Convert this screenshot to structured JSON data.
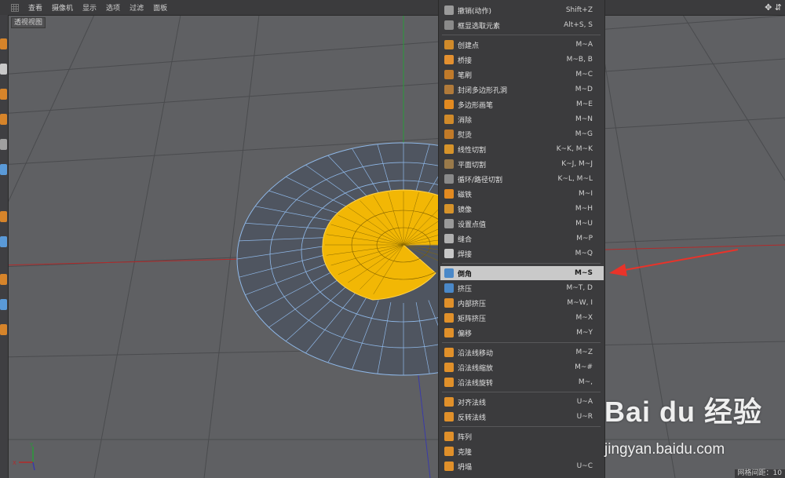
{
  "menubar": {
    "items": [
      "查看",
      "摄像机",
      "显示",
      "选项",
      "过滤",
      "面板"
    ]
  },
  "viewport": {
    "label": "透视视图",
    "grid_label": "网格间距：10"
  },
  "context_menu": {
    "items": [
      {
        "label": "撤销(动作)",
        "shortcut": "Shift+Z",
        "icon": "undo-icon",
        "color": "#9a9a9a"
      },
      {
        "label": "框显选取元素",
        "shortcut": "Alt+S, S",
        "icon": "frame-selected-icon",
        "color": "#8a8a8a"
      },
      {
        "label": "创建点",
        "shortcut": "M~A",
        "icon": "create-point-icon",
        "color": "#d08a2a"
      },
      {
        "label": "桥接",
        "shortcut": "M~B, B",
        "icon": "bridge-icon",
        "color": "#e39030"
      },
      {
        "label": "笔刷",
        "shortcut": "M~C",
        "icon": "brush-icon",
        "color": "#c07a2a"
      },
      {
        "label": "封闭多边形孔洞",
        "shortcut": "M~D",
        "icon": "close-hole-icon",
        "color": "#b07a3a"
      },
      {
        "label": "多边形画笔",
        "shortcut": "M~E",
        "icon": "polygon-pen-icon",
        "color": "#e38a20"
      },
      {
        "label": "消除",
        "shortcut": "M~N",
        "icon": "dissolve-icon",
        "color": "#d08a2a"
      },
      {
        "label": "熨烫",
        "shortcut": "M~G",
        "icon": "iron-icon",
        "color": "#c27a28"
      },
      {
        "label": "线性切割",
        "shortcut": "K~K, M~K",
        "icon": "line-cut-icon",
        "color": "#d6932a"
      },
      {
        "label": "平面切割",
        "shortcut": "K~J, M~J",
        "icon": "plane-cut-icon",
        "color": "#9a7a4a"
      },
      {
        "label": "循环/路径切割",
        "shortcut": "K~L, M~L",
        "icon": "loop-cut-icon",
        "color": "#8a8a8a"
      },
      {
        "label": "磁铁",
        "shortcut": "M~I",
        "icon": "magnet-icon",
        "color": "#e38a20"
      },
      {
        "label": "镜像",
        "shortcut": "M~H",
        "icon": "mirror-icon",
        "color": "#d6932a"
      },
      {
        "label": "设置点值",
        "shortcut": "M~U",
        "icon": "set-point-value-icon",
        "color": "#9a9a9a"
      },
      {
        "label": "缝合",
        "shortcut": "M~P",
        "icon": "stitch-icon",
        "color": "#b0b0b0"
      },
      {
        "label": "焊接",
        "shortcut": "M~Q",
        "icon": "weld-icon",
        "color": "#c8c8c8"
      },
      {
        "label": "倒角",
        "shortcut": "M~S",
        "icon": "bevel-icon",
        "color": "#4a88c8"
      },
      {
        "label": "挤压",
        "shortcut": "M~T, D",
        "icon": "extrude-icon",
        "color": "#4a88c8"
      },
      {
        "label": "内部挤压",
        "shortcut": "M~W, I",
        "icon": "extrude-inner-icon",
        "color": "#e0902a"
      },
      {
        "label": "矩阵挤压",
        "shortcut": "M~X",
        "icon": "matrix-extrude-icon",
        "color": "#e0902a"
      },
      {
        "label": "偏移",
        "shortcut": "M~Y",
        "icon": "smooth-shift-icon",
        "color": "#e0902a"
      },
      {
        "label": "沿法线移动",
        "shortcut": "M~Z",
        "icon": "normal-move-icon",
        "color": "#e0902a"
      },
      {
        "label": "沿法线缩放",
        "shortcut": "M~#",
        "icon": "normal-scale-icon",
        "color": "#e0902a"
      },
      {
        "label": "沿法线旋转",
        "shortcut": "M~,",
        "icon": "normal-rotate-icon",
        "color": "#e0902a"
      },
      {
        "label": "对齐法线",
        "shortcut": "U~A",
        "icon": "align-normals-icon",
        "color": "#e0902a"
      },
      {
        "label": "反转法线",
        "shortcut": "U~R",
        "icon": "reverse-normals-icon",
        "color": "#e0902a"
      },
      {
        "label": "阵列",
        "shortcut": "",
        "icon": "array-icon",
        "color": "#e0902a"
      },
      {
        "label": "克隆",
        "shortcut": "",
        "icon": "clone-icon",
        "color": "#e0902a"
      },
      {
        "label": "坍塌",
        "shortcut": "U~C",
        "icon": "collapse-icon",
        "color": "#e0902a"
      }
    ],
    "highlighted_index": 17
  },
  "watermark": {
    "logo": "Bai du 经验",
    "url": "jingyan.baidu.com"
  },
  "axis_labels": {
    "x": "X",
    "y": "Y"
  },
  "colors": {
    "selection": "#f2b705",
    "mesh_fill": "#4f5560",
    "mesh_edge": "#8fb8e8",
    "arrow": "#e8332a"
  }
}
